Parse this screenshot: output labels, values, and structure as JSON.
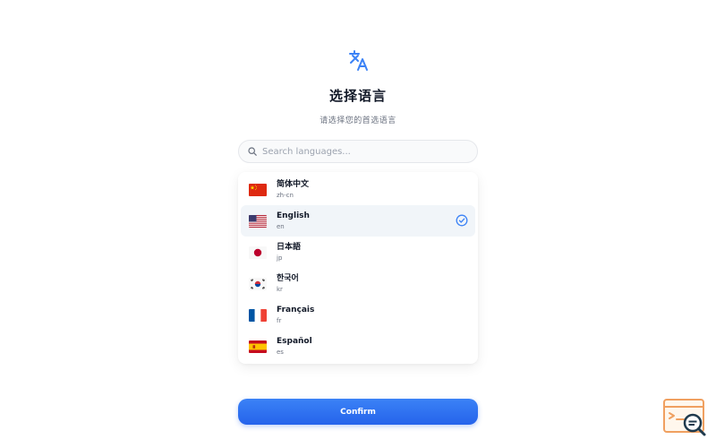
{
  "header": {
    "icon": "translate-icon",
    "title": "选择语言",
    "subtitle": "请选择您的首选语言"
  },
  "search": {
    "placeholder": "Search languages...",
    "value": ""
  },
  "languages": [
    {
      "name": "简体中文",
      "code": "zh-cn",
      "flag": "china-flag-icon",
      "selected": false
    },
    {
      "name": "English",
      "code": "en",
      "flag": "usa-flag-icon",
      "selected": true
    },
    {
      "name": "日本語",
      "code": "jp",
      "flag": "japan-flag-icon",
      "selected": false
    },
    {
      "name": "한국어",
      "code": "kr",
      "flag": "korea-flag-icon",
      "selected": false
    },
    {
      "name": "Français",
      "code": "fr",
      "flag": "france-flag-icon",
      "selected": false
    },
    {
      "name": "Español",
      "code": "es",
      "flag": "spain-flag-icon",
      "selected": false
    }
  ],
  "confirm_label": "Confirm",
  "colors": {
    "accent": "#2563eb",
    "selected_bg": "#f1f5f9",
    "check": "#3b82f6"
  }
}
